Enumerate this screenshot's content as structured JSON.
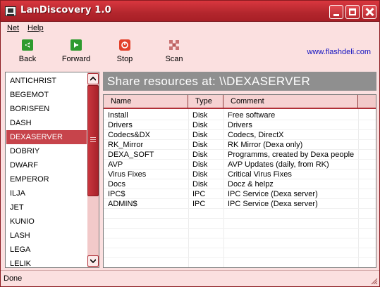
{
  "window": {
    "title": "LanDiscovery 1.0"
  },
  "menu": {
    "net": "Net",
    "help": "Help"
  },
  "toolbar": {
    "back": "Back",
    "forward": "Forward",
    "stop": "Stop",
    "scan": "Scan",
    "site": "www.flashdeli.com",
    "colors": {
      "back_icon": "#2e9a2e",
      "forward_icon": "#2e9a2e",
      "stop_icon": "#e2412a",
      "scan_icon": "#c87070"
    }
  },
  "computers": {
    "selected": "DEXASERVER",
    "items": [
      "ANTICHRIST",
      "BEGEMOT",
      "BORISFEN",
      "DASH",
      "DEXASERVER",
      "DOBRIY",
      "DWARF",
      "EMPEROR",
      "ILJA",
      "JET",
      "KUNIO",
      "LASH",
      "LEGA",
      "LELIK"
    ]
  },
  "share": {
    "header": "Share resources at: \\\\DEXASERVER",
    "columns": {
      "name": "Name",
      "type": "Type",
      "comment": "Comment"
    },
    "rows": [
      {
        "name": "Install",
        "type": "Disk",
        "comment": "Free software"
      },
      {
        "name": "Drivers",
        "type": "Disk",
        "comment": "Drivers"
      },
      {
        "name": "Codecs&DX",
        "type": "Disk",
        "comment": "Codecs, DirectX"
      },
      {
        "name": "RK_Mirror",
        "type": "Disk",
        "comment": "RK Mirror (Dexa only)"
      },
      {
        "name": "DEXA_SOFT",
        "type": "Disk",
        "comment": "Programms, created by Dexa people"
      },
      {
        "name": "AVP",
        "type": "Disk",
        "comment": "AVP Updates (daily, from RK)"
      },
      {
        "name": "Virus Fixes",
        "type": "Disk",
        "comment": "Critical Virus Fixes"
      },
      {
        "name": "Docs",
        "type": "Disk",
        "comment": "Docz & helpz"
      },
      {
        "name": "IPC$",
        "type": "IPC",
        "comment": "IPC Service (Dexa server)"
      },
      {
        "name": "ADMIN$",
        "type": "IPC",
        "comment": "IPC Service (Dexa server)"
      }
    ]
  },
  "status": {
    "text": "Done"
  },
  "theme": {
    "title_bar": "#b3262d",
    "selection": "#c7444b",
    "panel_bg": "#fbe0e0",
    "header_gray": "#8f8f8f",
    "link": "#1010c0"
  }
}
